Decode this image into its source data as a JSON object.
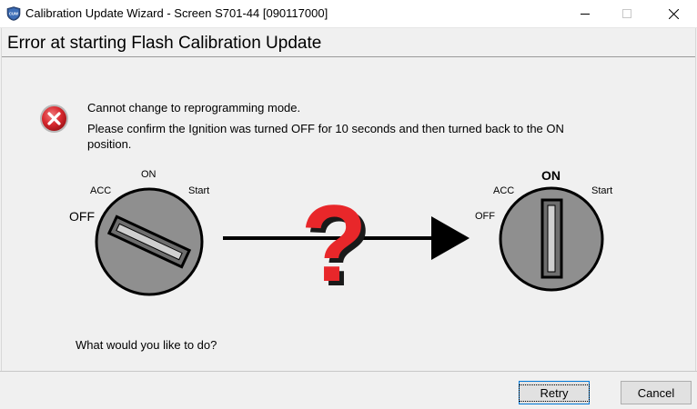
{
  "window": {
    "title": "Calibration Update Wizard - Screen S701-44 [090117000]",
    "app_icon_text": "CUW"
  },
  "banner": {
    "title": "Error at starting Flash Calibration Update"
  },
  "message": {
    "line1": "Cannot change to reprogramming mode.",
    "line2": "Please confirm the Ignition was turned OFF for 10 seconds and then turned back to the ON",
    "line3": "position."
  },
  "illustration": {
    "left_key": {
      "off": "OFF",
      "acc": "ACC",
      "on": "ON",
      "start": "Start"
    },
    "right_key": {
      "off": "OFF",
      "acc": "ACC",
      "on": "ON",
      "start": "Start"
    },
    "question_mark": "?"
  },
  "prompt": "What would you like to do?",
  "buttons": {
    "retry": "Retry",
    "cancel": "Cancel"
  },
  "colors": {
    "error_red": "#d8292f",
    "question_red": "#e8272a",
    "key_gray": "#8f8f8f",
    "accent_blue": "#0078d7"
  }
}
